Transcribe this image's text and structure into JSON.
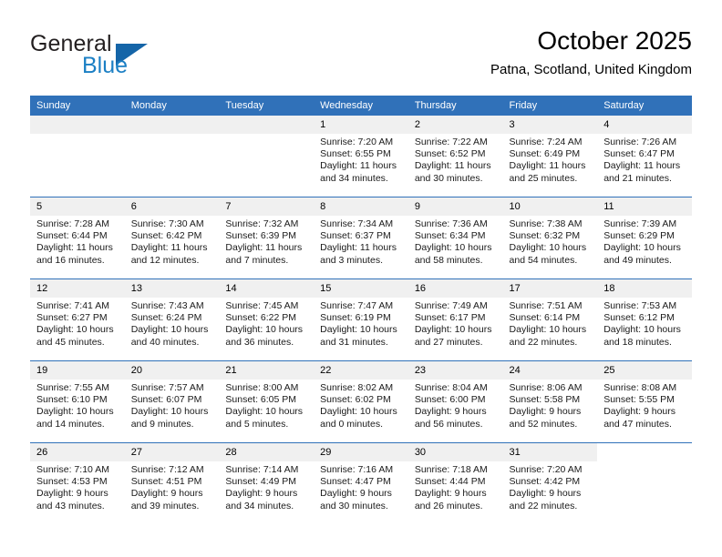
{
  "brand": {
    "name_part1": "General",
    "name_part2": "Blue",
    "logo_icon": "triangle-logo-icon"
  },
  "header": {
    "title": "October 2025",
    "subtitle": "Patna, Scotland, United Kingdom"
  },
  "colors": {
    "header_blue": "#3071b9",
    "brand_blue": "#1b7fc4",
    "daynum_band": "#f0f0f0"
  },
  "weekday_headers": [
    "Sunday",
    "Monday",
    "Tuesday",
    "Wednesday",
    "Thursday",
    "Friday",
    "Saturday"
  ],
  "labels": {
    "sunrise_prefix": "Sunrise:",
    "sunset_prefix": "Sunset:",
    "daylight_prefix": "Daylight:"
  },
  "weeks": [
    [
      {
        "day": "",
        "empty": true
      },
      {
        "day": "",
        "empty": true
      },
      {
        "day": "",
        "empty": true
      },
      {
        "day": "1",
        "sunrise": "Sunrise: 7:20 AM",
        "sunset": "Sunset: 6:55 PM",
        "daylight": "Daylight: 11 hours and 34 minutes."
      },
      {
        "day": "2",
        "sunrise": "Sunrise: 7:22 AM",
        "sunset": "Sunset: 6:52 PM",
        "daylight": "Daylight: 11 hours and 30 minutes."
      },
      {
        "day": "3",
        "sunrise": "Sunrise: 7:24 AM",
        "sunset": "Sunset: 6:49 PM",
        "daylight": "Daylight: 11 hours and 25 minutes."
      },
      {
        "day": "4",
        "sunrise": "Sunrise: 7:26 AM",
        "sunset": "Sunset: 6:47 PM",
        "daylight": "Daylight: 11 hours and 21 minutes."
      }
    ],
    [
      {
        "day": "5",
        "sunrise": "Sunrise: 7:28 AM",
        "sunset": "Sunset: 6:44 PM",
        "daylight": "Daylight: 11 hours and 16 minutes."
      },
      {
        "day": "6",
        "sunrise": "Sunrise: 7:30 AM",
        "sunset": "Sunset: 6:42 PM",
        "daylight": "Daylight: 11 hours and 12 minutes."
      },
      {
        "day": "7",
        "sunrise": "Sunrise: 7:32 AM",
        "sunset": "Sunset: 6:39 PM",
        "daylight": "Daylight: 11 hours and 7 minutes."
      },
      {
        "day": "8",
        "sunrise": "Sunrise: 7:34 AM",
        "sunset": "Sunset: 6:37 PM",
        "daylight": "Daylight: 11 hours and 3 minutes."
      },
      {
        "day": "9",
        "sunrise": "Sunrise: 7:36 AM",
        "sunset": "Sunset: 6:34 PM",
        "daylight": "Daylight: 10 hours and 58 minutes."
      },
      {
        "day": "10",
        "sunrise": "Sunrise: 7:38 AM",
        "sunset": "Sunset: 6:32 PM",
        "daylight": "Daylight: 10 hours and 54 minutes."
      },
      {
        "day": "11",
        "sunrise": "Sunrise: 7:39 AM",
        "sunset": "Sunset: 6:29 PM",
        "daylight": "Daylight: 10 hours and 49 minutes."
      }
    ],
    [
      {
        "day": "12",
        "sunrise": "Sunrise: 7:41 AM",
        "sunset": "Sunset: 6:27 PM",
        "daylight": "Daylight: 10 hours and 45 minutes."
      },
      {
        "day": "13",
        "sunrise": "Sunrise: 7:43 AM",
        "sunset": "Sunset: 6:24 PM",
        "daylight": "Daylight: 10 hours and 40 minutes."
      },
      {
        "day": "14",
        "sunrise": "Sunrise: 7:45 AM",
        "sunset": "Sunset: 6:22 PM",
        "daylight": "Daylight: 10 hours and 36 minutes."
      },
      {
        "day": "15",
        "sunrise": "Sunrise: 7:47 AM",
        "sunset": "Sunset: 6:19 PM",
        "daylight": "Daylight: 10 hours and 31 minutes."
      },
      {
        "day": "16",
        "sunrise": "Sunrise: 7:49 AM",
        "sunset": "Sunset: 6:17 PM",
        "daylight": "Daylight: 10 hours and 27 minutes."
      },
      {
        "day": "17",
        "sunrise": "Sunrise: 7:51 AM",
        "sunset": "Sunset: 6:14 PM",
        "daylight": "Daylight: 10 hours and 22 minutes."
      },
      {
        "day": "18",
        "sunrise": "Sunrise: 7:53 AM",
        "sunset": "Sunset: 6:12 PM",
        "daylight": "Daylight: 10 hours and 18 minutes."
      }
    ],
    [
      {
        "day": "19",
        "sunrise": "Sunrise: 7:55 AM",
        "sunset": "Sunset: 6:10 PM",
        "daylight": "Daylight: 10 hours and 14 minutes."
      },
      {
        "day": "20",
        "sunrise": "Sunrise: 7:57 AM",
        "sunset": "Sunset: 6:07 PM",
        "daylight": "Daylight: 10 hours and 9 minutes."
      },
      {
        "day": "21",
        "sunrise": "Sunrise: 8:00 AM",
        "sunset": "Sunset: 6:05 PM",
        "daylight": "Daylight: 10 hours and 5 minutes."
      },
      {
        "day": "22",
        "sunrise": "Sunrise: 8:02 AM",
        "sunset": "Sunset: 6:02 PM",
        "daylight": "Daylight: 10 hours and 0 minutes."
      },
      {
        "day": "23",
        "sunrise": "Sunrise: 8:04 AM",
        "sunset": "Sunset: 6:00 PM",
        "daylight": "Daylight: 9 hours and 56 minutes."
      },
      {
        "day": "24",
        "sunrise": "Sunrise: 8:06 AM",
        "sunset": "Sunset: 5:58 PM",
        "daylight": "Daylight: 9 hours and 52 minutes."
      },
      {
        "day": "25",
        "sunrise": "Sunrise: 8:08 AM",
        "sunset": "Sunset: 5:55 PM",
        "daylight": "Daylight: 9 hours and 47 minutes."
      }
    ],
    [
      {
        "day": "26",
        "sunrise": "Sunrise: 7:10 AM",
        "sunset": "Sunset: 4:53 PM",
        "daylight": "Daylight: 9 hours and 43 minutes."
      },
      {
        "day": "27",
        "sunrise": "Sunrise: 7:12 AM",
        "sunset": "Sunset: 4:51 PM",
        "daylight": "Daylight: 9 hours and 39 minutes."
      },
      {
        "day": "28",
        "sunrise": "Sunrise: 7:14 AM",
        "sunset": "Sunset: 4:49 PM",
        "daylight": "Daylight: 9 hours and 34 minutes."
      },
      {
        "day": "29",
        "sunrise": "Sunrise: 7:16 AM",
        "sunset": "Sunset: 4:47 PM",
        "daylight": "Daylight: 9 hours and 30 minutes."
      },
      {
        "day": "30",
        "sunrise": "Sunrise: 7:18 AM",
        "sunset": "Sunset: 4:44 PM",
        "daylight": "Daylight: 9 hours and 26 minutes."
      },
      {
        "day": "31",
        "sunrise": "Sunrise: 7:20 AM",
        "sunset": "Sunset: 4:42 PM",
        "daylight": "Daylight: 9 hours and 22 minutes."
      },
      {
        "day": "",
        "blank": true
      }
    ]
  ]
}
